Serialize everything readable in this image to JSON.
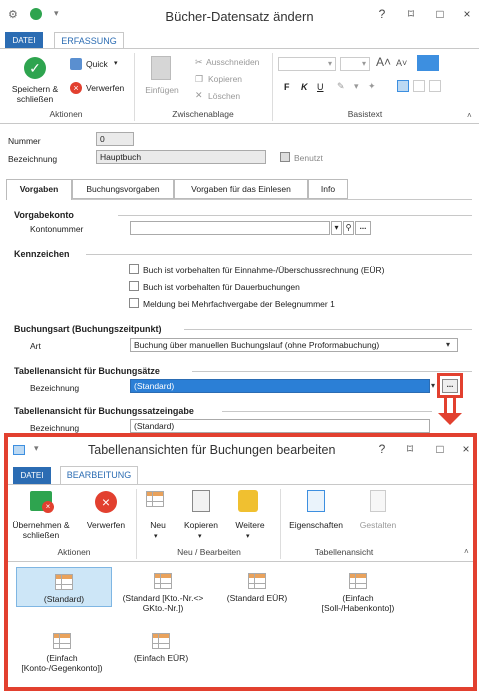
{
  "window": {
    "title": "Bücher-Datensatz ändern",
    "controls": [
      "?",
      "⌑",
      "□",
      "×"
    ]
  },
  "ribbon": {
    "tabs": [
      "DATEI",
      "ERFASSUNG"
    ],
    "groups": {
      "aktionen": {
        "label": "Aktionen",
        "save_close": "Speichern & schließen",
        "quick": "Quick",
        "discard": "Verwerfen"
      },
      "zwischenablage": {
        "label": "Zwischenablage",
        "paste": "Einfügen",
        "cut": "Ausschneiden",
        "copy": "Kopieren",
        "delete": "Löschen"
      },
      "basistext": {
        "label": "Basistext",
        "bold": "F",
        "italic": "K",
        "underline": "U"
      }
    }
  },
  "form": {
    "nummer_label": "Nummer",
    "nummer_value": "0",
    "bezeichnung_label": "Bezeichnung",
    "bezeichnung_value": "Hauptbuch",
    "benutzt_label": "Benutzt",
    "tabs": [
      "Vorgaben",
      "Buchungsvorgaben",
      "Vorgaben für das Einlesen",
      "Info"
    ],
    "vorgabekonto": {
      "title": "Vorgabekonto",
      "kontonummer_label": "Kontonummer",
      "kontonummer_value": ""
    },
    "kennzeichen": {
      "title": "Kennzeichen",
      "checkboxes": [
        "Buch ist vorbehalten für Einnahme-/Überschussrechnung (EÜR)",
        "Buch ist vorbehalten für Dauerbuchungen",
        "Meldung bei Mehrfachvergabe der Belegnummer 1"
      ]
    },
    "buchungsart": {
      "title": "Buchungsart (Buchungszeitpunkt)",
      "art_label": "Art",
      "art_value": "Buchung über manuellen Buchungslauf (ohne Proformabuchung)"
    },
    "tabellenansicht_saetze": {
      "title": "Tabellenansicht für Buchungsätze",
      "bezeichnung_label": "Bezeichnung",
      "bezeichnung_value": "(Standard)",
      "more_button": "..."
    },
    "tabellenansicht_eingabe": {
      "title": "Tabellenansicht für Buchungssatzeingabe",
      "bezeichnung_label": "Bezeichnung",
      "bezeichnung_value": "(Standard)"
    }
  },
  "dialog": {
    "title": "Tabellenansichten für Buchungen bearbeiten",
    "controls": [
      "?",
      "⌑",
      "□",
      "×"
    ],
    "tabs": [
      "DATEI",
      "BEARBEITUNG"
    ],
    "groups": {
      "aktionen": {
        "label": "Aktionen",
        "apply_close": "Übernehmen & schließen",
        "discard": "Verwerfen"
      },
      "neu_bearbeiten": {
        "label": "Neu / Bearbeiten",
        "new": "Neu",
        "copy": "Kopieren",
        "more": "Weitere"
      },
      "tabellenansicht": {
        "label": "Tabellenansicht",
        "properties": "Eigenschaften",
        "design": "Gestalten"
      }
    },
    "views": [
      "(Standard)",
      "(Standard [Kto.-Nr.<> GKto.-Nr.])",
      "(Standard EÜR)",
      "(Einfach [Soll-/Habenkonto])",
      "(Einfach [Konto-/Gegenkonto])",
      "(Einfach EÜR)"
    ]
  },
  "colors": {
    "accent_blue": "#2b6cb3",
    "highlight_red": "#e2402f",
    "selection_blue": "#cde6f7"
  }
}
